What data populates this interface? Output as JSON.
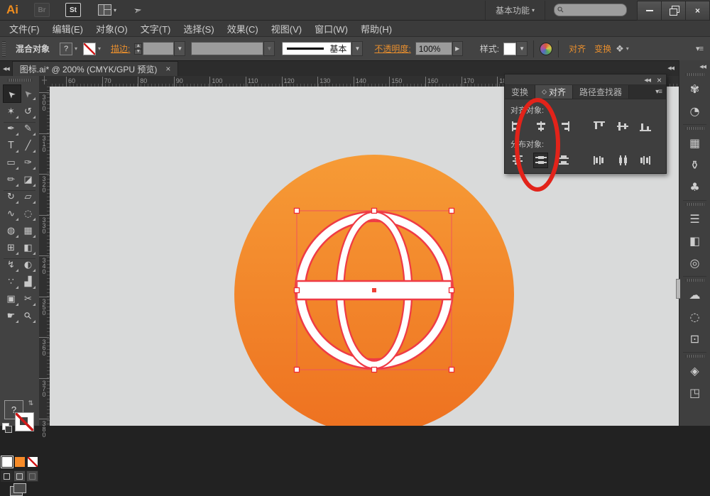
{
  "app": {
    "logo": "Ai",
    "bridge": "Br",
    "stock": "St",
    "workspace": "基本功能",
    "search_placeholder": ""
  },
  "window_controls": {
    "minimize": "minimize",
    "restore": "restore",
    "close": "×"
  },
  "menubar": [
    "文件(F)",
    "编辑(E)",
    "对象(O)",
    "文字(T)",
    "选择(S)",
    "效果(C)",
    "视图(V)",
    "窗口(W)",
    "帮助(H)"
  ],
  "controlbar": {
    "selection_label": "混合对象",
    "fill_mixed": "?",
    "stroke_label": "描边:",
    "brush_style": "基本",
    "opacity_label": "不透明度:",
    "opacity_value": "100%",
    "style_label": "样式:",
    "align_link": "对齐",
    "transform_link": "变换",
    "accent_color": "#e78e2e"
  },
  "document_tab": {
    "title": "图标.ai* @ 200% (CMYK/GPU 预览)",
    "close": "×"
  },
  "rulers": {
    "top_labels": [
      "60",
      "70",
      "80",
      "90",
      "100",
      "110",
      "120",
      "130",
      "140",
      "150",
      "160",
      "170",
      "180"
    ],
    "left_labels": [
      "300",
      "310",
      "320",
      "330",
      "340",
      "350",
      "360",
      "370",
      "380"
    ]
  },
  "toolbar_tools": [
    {
      "name": "selection-tool",
      "glyph": "➤",
      "rotate": -135,
      "active": true
    },
    {
      "name": "direct-selection-tool",
      "glyph": "➤",
      "rotate": -135,
      "dim": true
    },
    {
      "name": "magic-wand-tool",
      "glyph": "✶"
    },
    {
      "name": "lasso-tool",
      "glyph": "↺"
    },
    {
      "name": "pen-tool",
      "glyph": "✒"
    },
    {
      "name": "curvature-tool",
      "glyph": "✎"
    },
    {
      "name": "type-tool",
      "glyph": "T"
    },
    {
      "name": "line-segment-tool",
      "glyph": "╱"
    },
    {
      "name": "rectangle-tool",
      "glyph": "▭"
    },
    {
      "name": "paintbrush-tool",
      "glyph": "✑"
    },
    {
      "name": "pencil-tool",
      "glyph": "✏"
    },
    {
      "name": "eraser-tool",
      "glyph": "◪"
    },
    {
      "name": "rotate-tool",
      "glyph": "↻"
    },
    {
      "name": "scale-tool",
      "glyph": "▱"
    },
    {
      "name": "width-tool",
      "glyph": "∿"
    },
    {
      "name": "free-transform-tool",
      "glyph": "◌"
    },
    {
      "name": "shape-builder-tool",
      "glyph": "◍"
    },
    {
      "name": "perspective-grid-tool",
      "glyph": "▦"
    },
    {
      "name": "mesh-tool",
      "glyph": "⊞"
    },
    {
      "name": "gradient-tool",
      "glyph": "◧"
    },
    {
      "name": "eyedropper-tool",
      "glyph": "↯"
    },
    {
      "name": "blend-tool",
      "glyph": "◐"
    },
    {
      "name": "symbol-sprayer-tool",
      "glyph": "∵"
    },
    {
      "name": "graph-tool",
      "glyph": "▟"
    },
    {
      "name": "artboard-tool",
      "glyph": "▣"
    },
    {
      "name": "slice-tool",
      "glyph": "✂"
    },
    {
      "name": "hand-tool",
      "glyph": "☛"
    },
    {
      "name": "zoom-tool",
      "glyph": "⚲",
      "rotate": -45
    }
  ],
  "dock_icons": [
    {
      "name": "color-panel-icon",
      "glyph": "✾"
    },
    {
      "name": "color-guide-icon",
      "glyph": "◔"
    },
    {
      "name": "swatches-icon",
      "glyph": "▦",
      "sep": true
    },
    {
      "name": "brushes-icon",
      "glyph": "⚱"
    },
    {
      "name": "symbols-icon",
      "glyph": "♣"
    },
    {
      "name": "stroke-icon",
      "glyph": "☰",
      "sep": true
    },
    {
      "name": "gradient-icon",
      "glyph": "◧"
    },
    {
      "name": "transparency-icon",
      "glyph": "◎"
    },
    {
      "name": "creative-cloud-icon",
      "glyph": "☁",
      "sep": true
    },
    {
      "name": "appearance-icon",
      "glyph": "◌"
    },
    {
      "name": "graphic-styles-icon",
      "glyph": "⊡"
    },
    {
      "name": "layers-icon",
      "glyph": "◈",
      "sep": true
    },
    {
      "name": "artboards-icon",
      "glyph": "◳"
    }
  ],
  "align_panel": {
    "tabs": [
      {
        "label": "变换",
        "active": false
      },
      {
        "label": "对齐",
        "prefix": "◇",
        "active": true
      },
      {
        "label": "路径查找器",
        "active": false
      }
    ],
    "align_section_label": "对齐对象:",
    "distribute_section_label": "分布对象:",
    "align_buttons": [
      "horizontal-align-left",
      "horizontal-align-center",
      "horizontal-align-right",
      "vertical-align-top",
      "vertical-align-center",
      "vertical-align-bottom"
    ],
    "distribute_buttons": [
      "vertical-distribute-top",
      "vertical-distribute-center",
      "vertical-distribute-bottom",
      "horizontal-distribute-left",
      "horizontal-distribute-center",
      "horizontal-distribute-right"
    ],
    "pressed_button": "vertical-distribute-center"
  },
  "canvas": {
    "background": "#d9dada",
    "circle_top_color": "#f69b36",
    "circle_bottom_color": "#ee7120",
    "selection_color": "#ef3b45"
  },
  "annotation": {
    "shape": "ellipse",
    "color": "#e2231a"
  },
  "chrome": {
    "collapse_glyph": "◀◀",
    "panel_menu_glyph": "▾≡",
    "corner_glyph": "┼",
    "shape_mode_glyph": "❖",
    "swap_glyph": "⇄",
    "share_glyph": "➣"
  }
}
